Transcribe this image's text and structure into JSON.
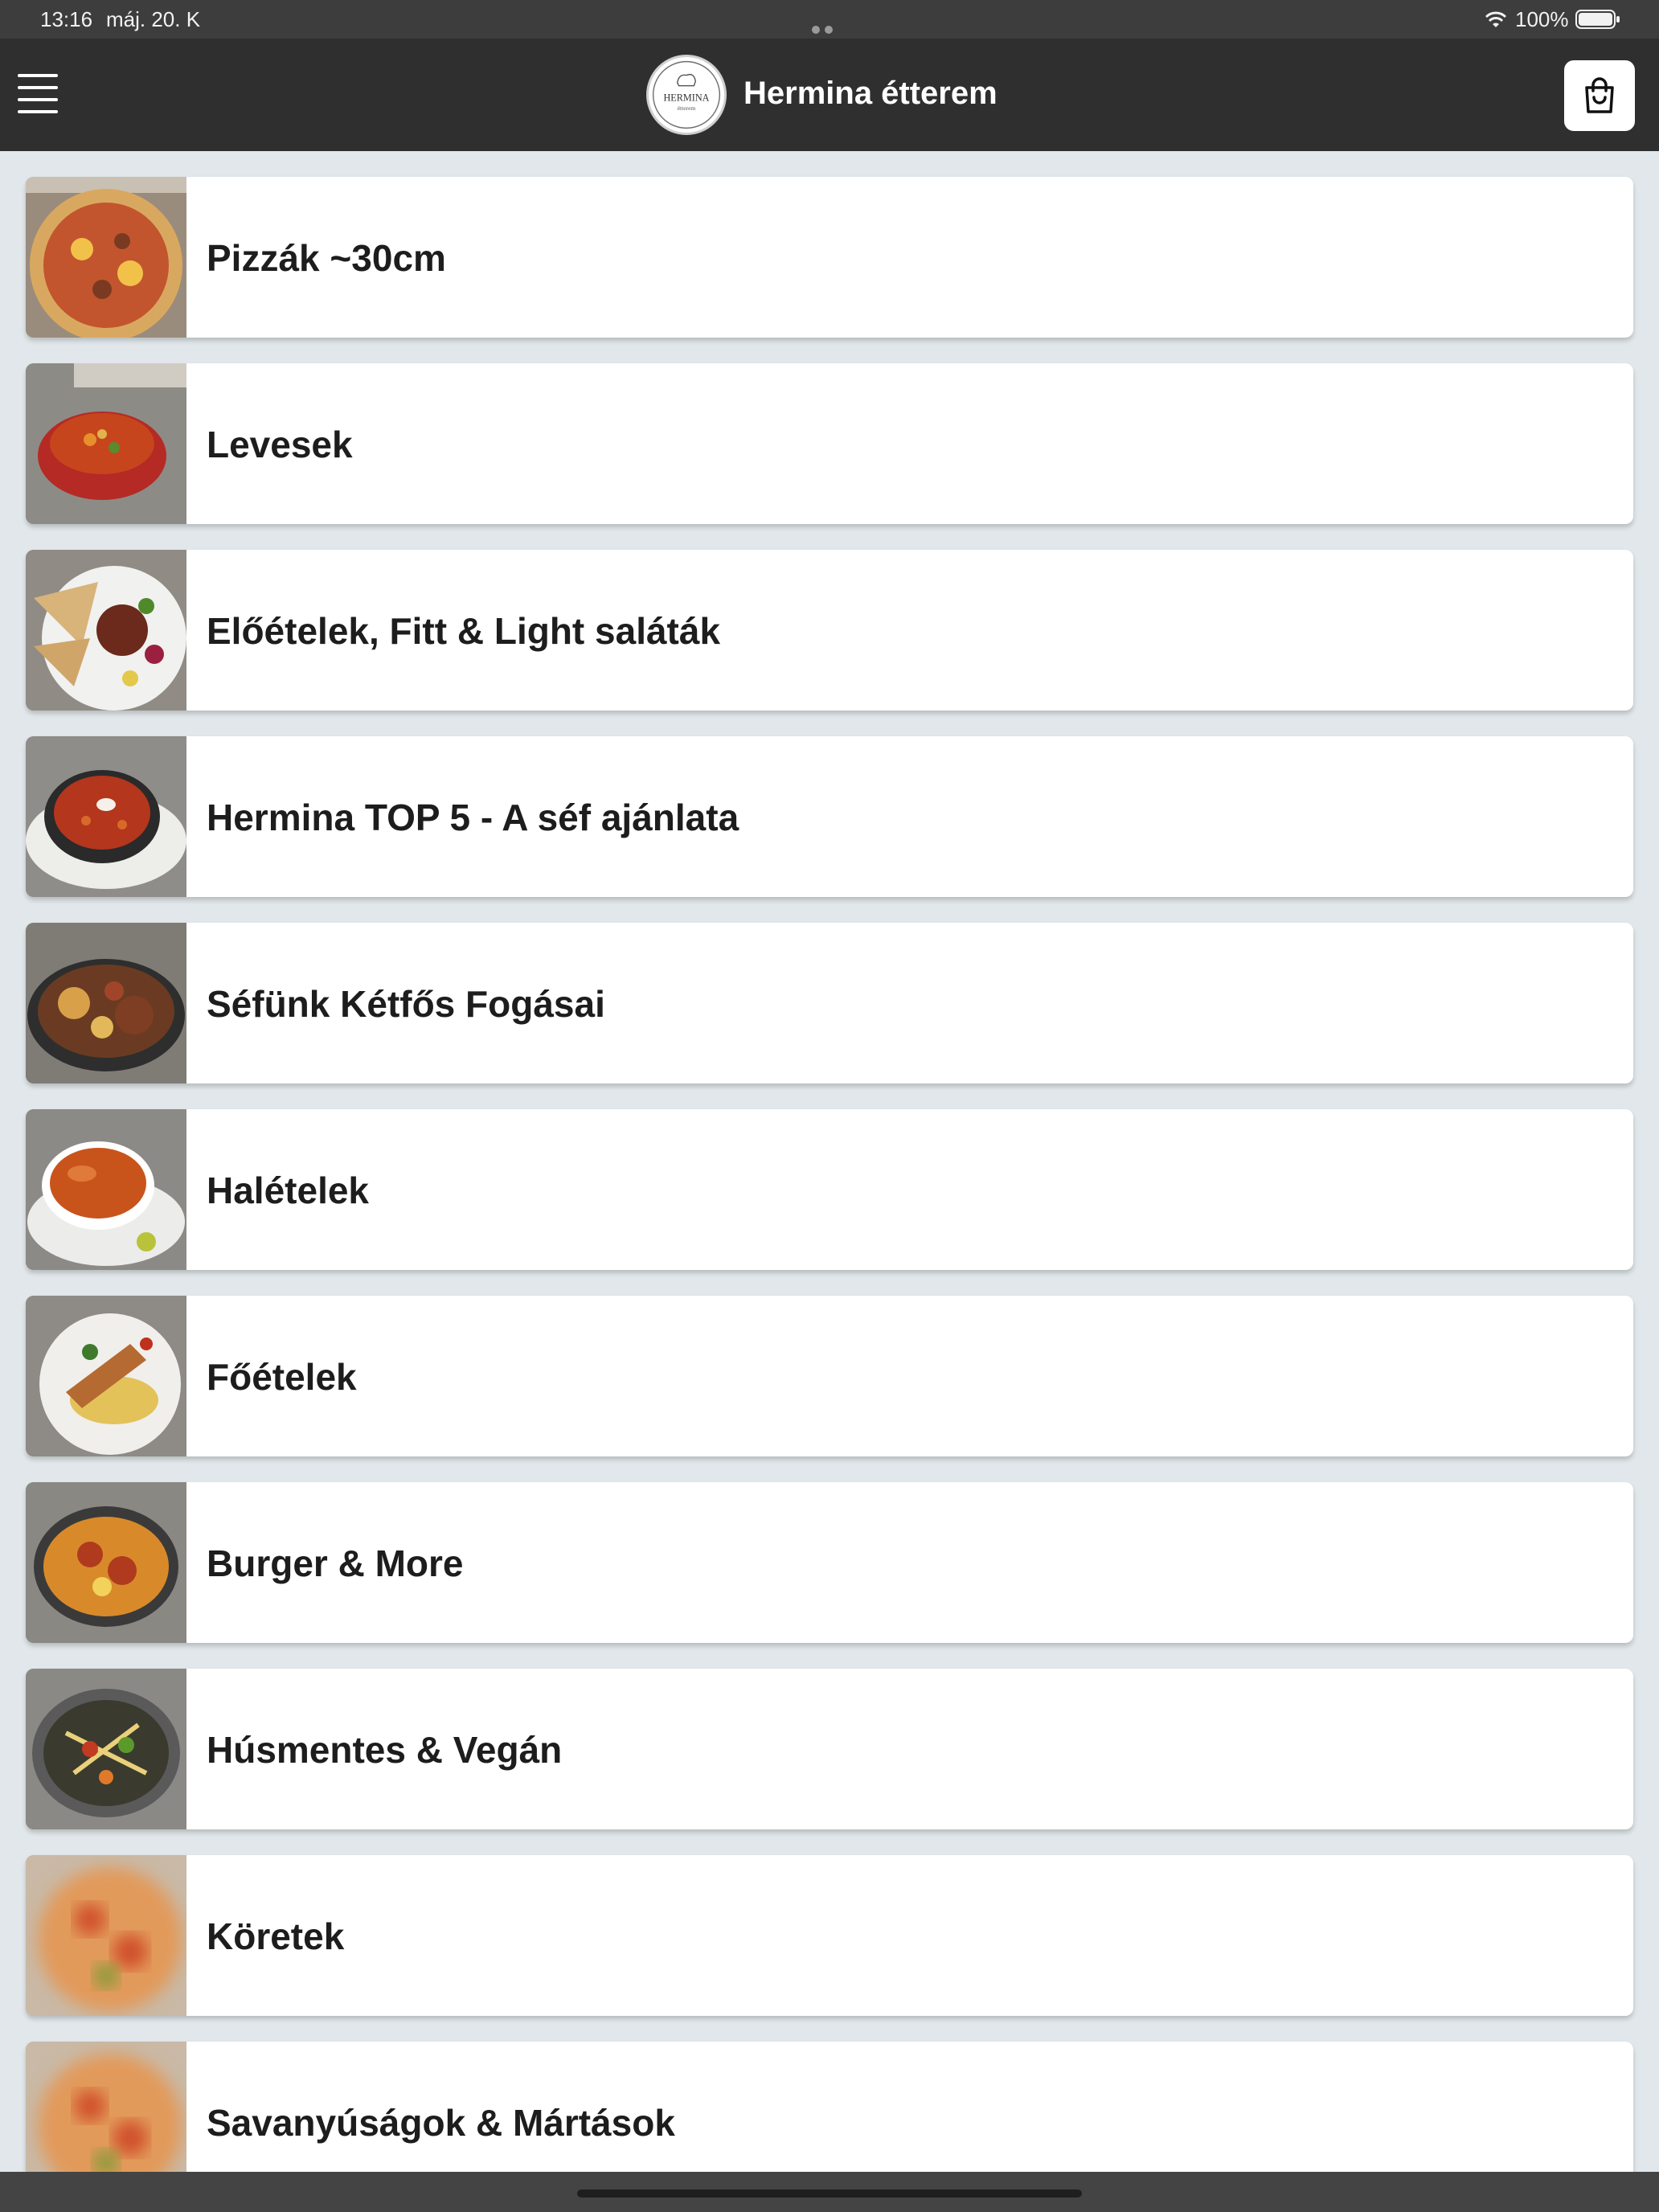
{
  "status_bar": {
    "time": "13:16",
    "date": "máj. 20. K",
    "battery": "100%"
  },
  "header": {
    "title": "Hermina étterem",
    "logo_text": "HERMINA",
    "logo_subtext": "étterem",
    "menu_icon": "hamburger-menu-icon",
    "cart_icon": "shopping-bag-icon"
  },
  "categories": [
    {
      "label": "Pizzák ~30cm"
    },
    {
      "label": "Levesek"
    },
    {
      "label": "Előételek, Fitt & Light saláták"
    },
    {
      "label": "Hermina TOP 5 - A séf ajánlata"
    },
    {
      "label": "Séfünk Kétfős Fogásai"
    },
    {
      "label": "Halételek"
    },
    {
      "label": "Főételek"
    },
    {
      "label": "Burger & More"
    },
    {
      "label": "Húsmentes & Vegán"
    },
    {
      "label": "Köretek"
    },
    {
      "label": "Savanyúságok & Mártások"
    }
  ],
  "colors": {
    "header_bg": "#2f2f2f",
    "page_bg": "#e1e7ea",
    "card_bg": "#ffffff",
    "text": "#1d1d1d"
  }
}
